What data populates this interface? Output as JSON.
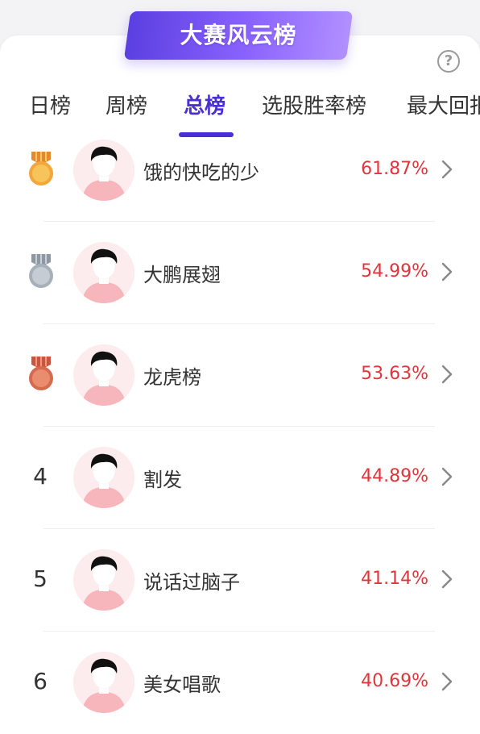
{
  "header": {
    "title": "大赛风云榜",
    "help_icon": "help-circle-icon",
    "help_glyph": "?"
  },
  "tabs": [
    {
      "label": "日榜",
      "active": false
    },
    {
      "label": "周榜",
      "active": false
    },
    {
      "label": "总榜",
      "active": true
    },
    {
      "label": "选股胜率榜",
      "active": false
    },
    {
      "label": "最大回报",
      "active": false
    }
  ],
  "colors": {
    "accent": "#4a2fd6",
    "rate": "#e0353b",
    "gold": "#e8a030",
    "silver": "#9aa3ad",
    "bronze": "#d0634a"
  },
  "leaderboard": [
    {
      "rank": "1",
      "badge": "gold-medal-icon",
      "name": "饿的快吃的少",
      "rate": "61.87%"
    },
    {
      "rank": "2",
      "badge": "silver-medal-icon",
      "name": "大鹏展翅",
      "rate": "54.99%"
    },
    {
      "rank": "3",
      "badge": "bronze-medal-icon",
      "name": "龙虎榜",
      "rate": "53.63%"
    },
    {
      "rank": "4",
      "badge": "",
      "name": "割发",
      "rate": "44.89%"
    },
    {
      "rank": "5",
      "badge": "",
      "name": "说话过脑子",
      "rate": "41.14%"
    },
    {
      "rank": "6",
      "badge": "",
      "name": "美女唱歌",
      "rate": "40.69%"
    }
  ]
}
